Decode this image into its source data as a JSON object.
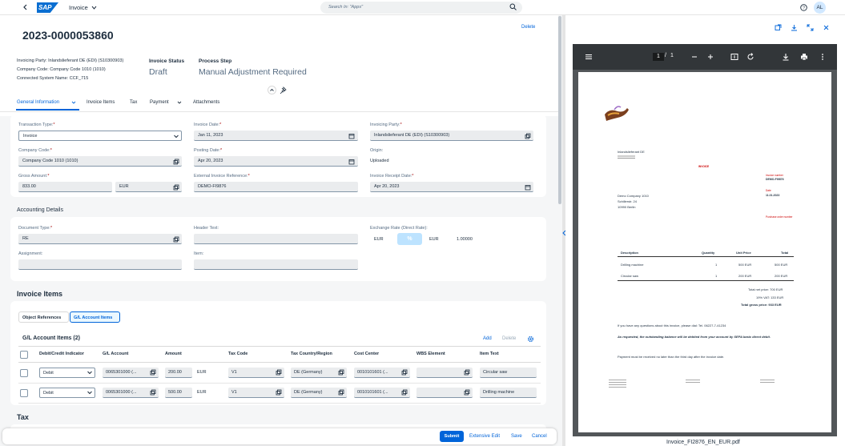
{
  "shell": {
    "app_title": "Invoice",
    "search_placeholder": "Search In: \"Apps\"",
    "avatar_initials": "AL",
    "logo_text": "SAP"
  },
  "header": {
    "title": "2023-0000053860",
    "delete_label": "Delete",
    "invoicing_party": "Invoicing Party: Inlandslieferant DE (EDI) (S10300903)",
    "company_code": "Company Code: Company Code 1010 (1010)",
    "connected_system": "Connected System Name: CCF_715",
    "invoice_status_label": "Invoice Status",
    "invoice_status_value": "Draft",
    "process_step_label": "Process Step",
    "process_step_value": "Manual Adjustment Required"
  },
  "tabs": [
    {
      "label": "General Information"
    },
    {
      "label": "Invoice Items"
    },
    {
      "label": "Tax"
    },
    {
      "label": "Payment"
    },
    {
      "label": "Attachments"
    }
  ],
  "general": {
    "transaction_type_label": "Transaction Type:",
    "transaction_type_value": "Invoice",
    "invoice_date_label": "Invoice Date:",
    "invoice_date_value": "Jan 11, 2023",
    "invoicing_party_label": "Invoicing Party:",
    "invoicing_party_value": "Inlandslieferant DE (EDI) (S10300903)",
    "company_code_label": "Company Code:",
    "company_code_value": "Company Code 1010 (1010)",
    "posting_date_label": "Posting Date:",
    "posting_date_value": "Apr 20, 2023",
    "origin_label": "Origin:",
    "origin_value": "Uploaded",
    "gross_amount_label": "Gross Amount:",
    "gross_amount_value": "833.00",
    "currency_value": "EUR",
    "external_ref_label": "External Invoice Reference:",
    "external_ref_value": "DEMO-FI9876",
    "receipt_date_label": "Invoice Receipt Date:",
    "receipt_date_value": "Apr 20, 2023",
    "required_mark": "*"
  },
  "accounting": {
    "title": "Accounting Details",
    "doc_type_label": "Document Type:",
    "doc_type_value": "RE",
    "header_text_label": "Header Text:",
    "exchange_rate_label": "Exchange Rate (Direct Rate):",
    "from_currency": "EUR",
    "to_currency": "EUR",
    "rate_value": "1.00000",
    "rate_button": "%",
    "assignment_label": "Assignment:",
    "item_label": "Item:"
  },
  "invoice_items": {
    "title": "Invoice Items",
    "seg_object": "Object References",
    "seg_gl": "G/L Account Items",
    "gl_title": "G/L Account Items (2)",
    "add_label": "Add",
    "delete_label": "Delete",
    "columns": [
      "Debit/Credit Indicator",
      "G/L Account",
      "Amount",
      "Tax Code",
      "Tax Country/Region",
      "Cost Center",
      "WBS Element",
      "Item Text"
    ],
    "rows": [
      {
        "indicator": "Debit",
        "gl_account": "0065301000 (...",
        "amount": "200.00",
        "currency": "EUR",
        "tax_code": "V1",
        "tax_country": "DE (Germany)",
        "cost_center": "0010101601 (...",
        "wbs": "",
        "item_text": "Circular saw"
      },
      {
        "indicator": "Debit",
        "gl_account": "0065301000 (...",
        "amount": "500.00",
        "currency": "EUR",
        "tax_code": "V1",
        "tax_country": "DE (Germany)",
        "cost_center": "0010101601 (...",
        "wbs": "",
        "item_text": "Drilling machine"
      }
    ]
  },
  "tax": {
    "title": "Tax"
  },
  "footer": {
    "submit": "Submit",
    "extensive_edit": "Extensive Edit",
    "save": "Save",
    "cancel": "Cancel"
  },
  "pdf": {
    "page_current": "1",
    "page_sep": "/",
    "page_total": "1",
    "filename": "Invoice_FI2876_EN_EUR.pdf",
    "doc": {
      "sender": "Inlandslieferant DE",
      "invoice_heading": "INVOICE",
      "invoice_number_label": "Invoice number",
      "invoice_number": "DEMO-FI9876",
      "date_label": "Date",
      "date": "11.01.2023",
      "recipient_line1": "Demo Company 1010",
      "recipient_line2": "Schillerstr. 24",
      "recipient_line3": "10990 Berlin",
      "po_label": "Purchase order number",
      "col_description": "Description",
      "col_quantity": "Quantity",
      "col_unit_price": "Unit Price",
      "col_total": "Total",
      "items": [
        {
          "desc": "Drilling machine",
          "qty": "1",
          "unit": "500 EUR",
          "total": "500 EUR"
        },
        {
          "desc": "Circular saw",
          "qty": "1",
          "unit": "200 EUR",
          "total": "200 EUR"
        }
      ],
      "net": "Total net price: 700 EUR",
      "vat": "19% VAT: 133 EUR",
      "gross": "Total gross price: 933 EUR",
      "questions": "If you have any questions about this invoice, please dial: Tel. 06227-7-41234",
      "sepa": "As requested, the outstanding balance will be debited from your account by SEPA basic direct debit.",
      "payment": "Payment must be received no later than the third day after the invoice date."
    }
  },
  "colors": {
    "accent": "#0064d9",
    "required": "#aa0808",
    "pdf_red": "#cc0000"
  }
}
